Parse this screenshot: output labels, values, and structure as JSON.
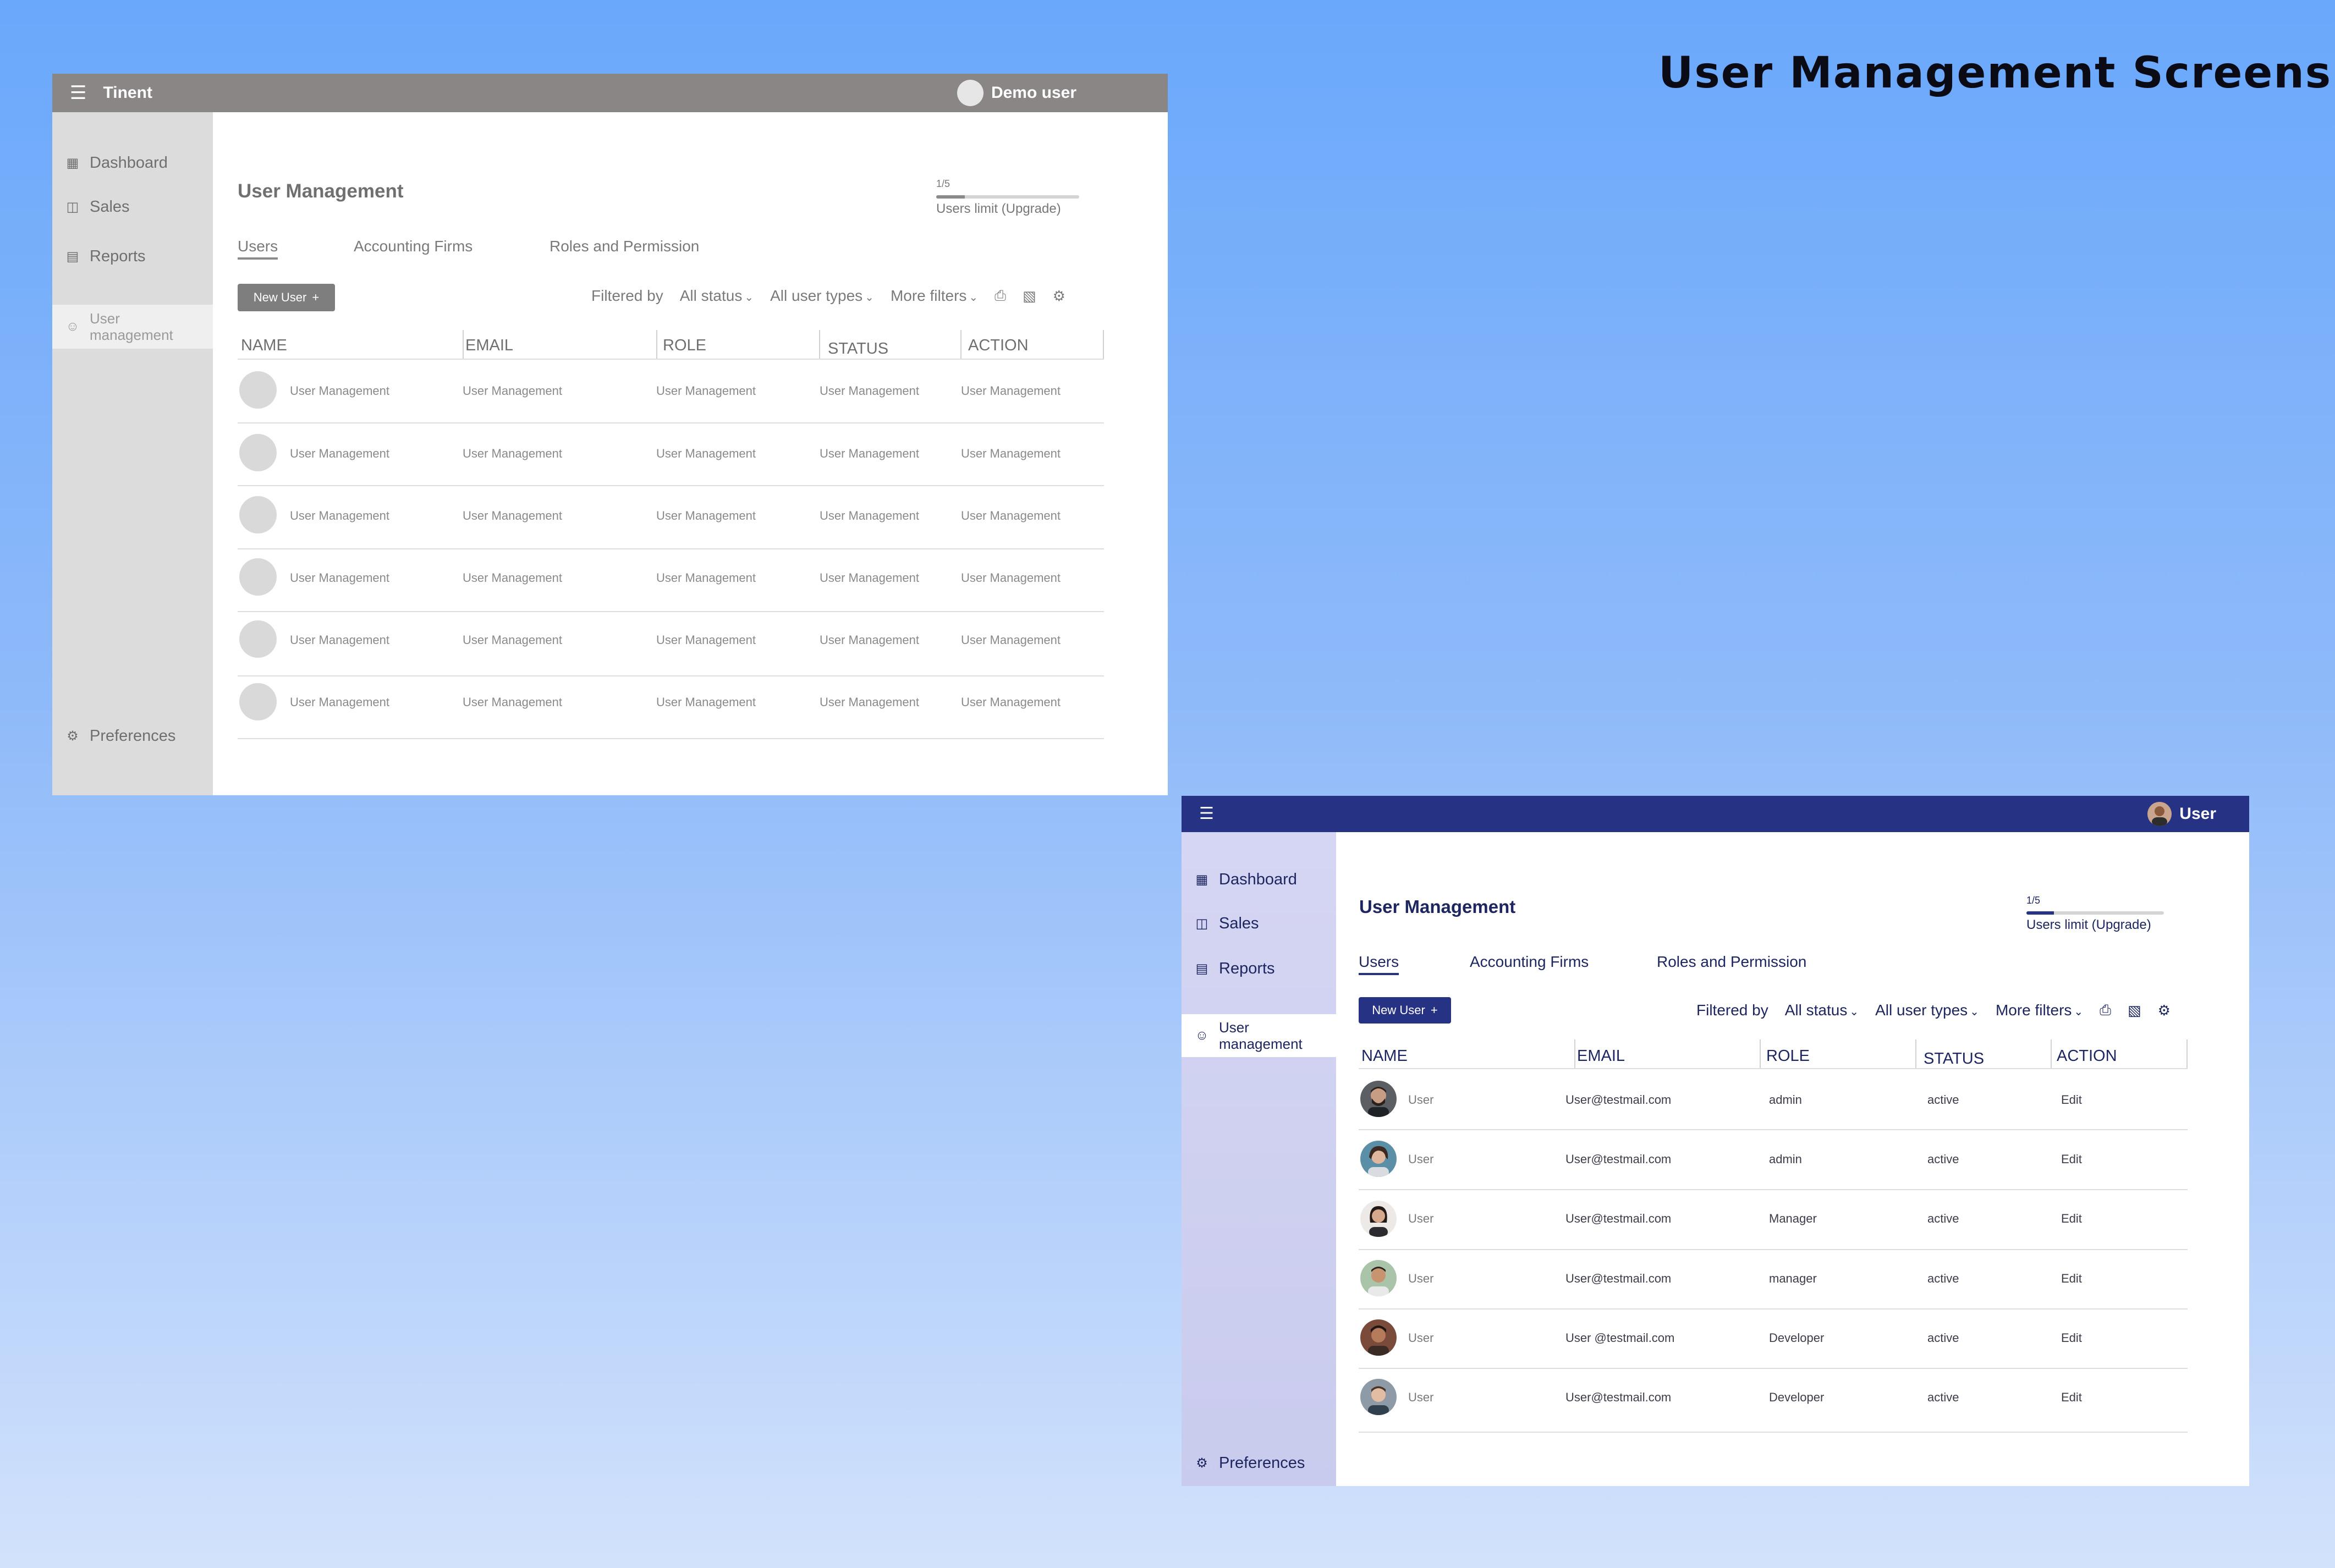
{
  "heading": "User Management Screens",
  "wireframe": {
    "burger_icon": "menu-icon",
    "brand": "Tinent",
    "user_name": "Demo user",
    "nav": [
      "Dashboard",
      "Sales",
      "Reports",
      "User management",
      "Preferences"
    ],
    "title": "User Management",
    "limit_count": "1/5",
    "limit_label": "Users limit (Upgrade)",
    "limit_fraction": 0.2,
    "tabs": [
      "Users",
      "Accounting Firms",
      "Roles and Permission"
    ],
    "new_user": "New User",
    "filters": {
      "label": "Filtered by",
      "status": "All status",
      "types": "All user types",
      "more": "More filters"
    },
    "columns": [
      "NAME",
      "EMAIL",
      "ROLE",
      "STATUS",
      "ACTION"
    ],
    "rows": [
      [
        "User Management",
        "User Management",
        "User Management",
        "User Management",
        "User Management"
      ],
      [
        "User Management",
        "User Management",
        "User Management",
        "User Management",
        "User Management"
      ],
      [
        "User Management",
        "User Management",
        "User Management",
        "User Management",
        "User Management"
      ],
      [
        "User Management",
        "User Management",
        "User Management",
        "User Management",
        "User Management"
      ],
      [
        "User Management",
        "User Management",
        "User Management",
        "User Management",
        "User Management"
      ],
      [
        "User Management",
        "User Management",
        "User Management",
        "User Management",
        "User Management"
      ]
    ]
  },
  "final": {
    "burger_icon": "menu-icon",
    "user_name": "User",
    "nav": [
      "Dashboard",
      "Sales",
      "Reports",
      "User management",
      "Preferences"
    ],
    "title": "User Management",
    "limit_count": "1/5",
    "limit_label": "Users limit (Upgrade)",
    "limit_fraction": 0.2,
    "tabs": [
      "Users",
      "Accounting Firms",
      "Roles and Permission"
    ],
    "new_user": "New User",
    "filters": {
      "label": "Filtered by",
      "status": "All status",
      "types": "All user types",
      "more": "More filters"
    },
    "columns": [
      "NAME",
      "EMAIL",
      "ROLE",
      "STATUS",
      "ACTION"
    ],
    "rows": [
      [
        "User",
        "User@testmail.com",
        "admin",
        "active",
        "Edit"
      ],
      [
        "User",
        "User@testmail.com",
        "admin",
        "active",
        "Edit"
      ],
      [
        "User",
        "User@testmail.com",
        "Manager",
        "active",
        "Edit"
      ],
      [
        "User",
        "User@testmail.com",
        "manager",
        "active",
        "Edit"
      ],
      [
        "User",
        "User @testmail.com",
        "Developer",
        "active",
        "Edit"
      ],
      [
        "User",
        "User@testmail.com",
        "Developer",
        "active",
        "Edit"
      ]
    ]
  },
  "colors": {
    "wire_bar": "#8a8686",
    "brand_navy": "#263284"
  }
}
